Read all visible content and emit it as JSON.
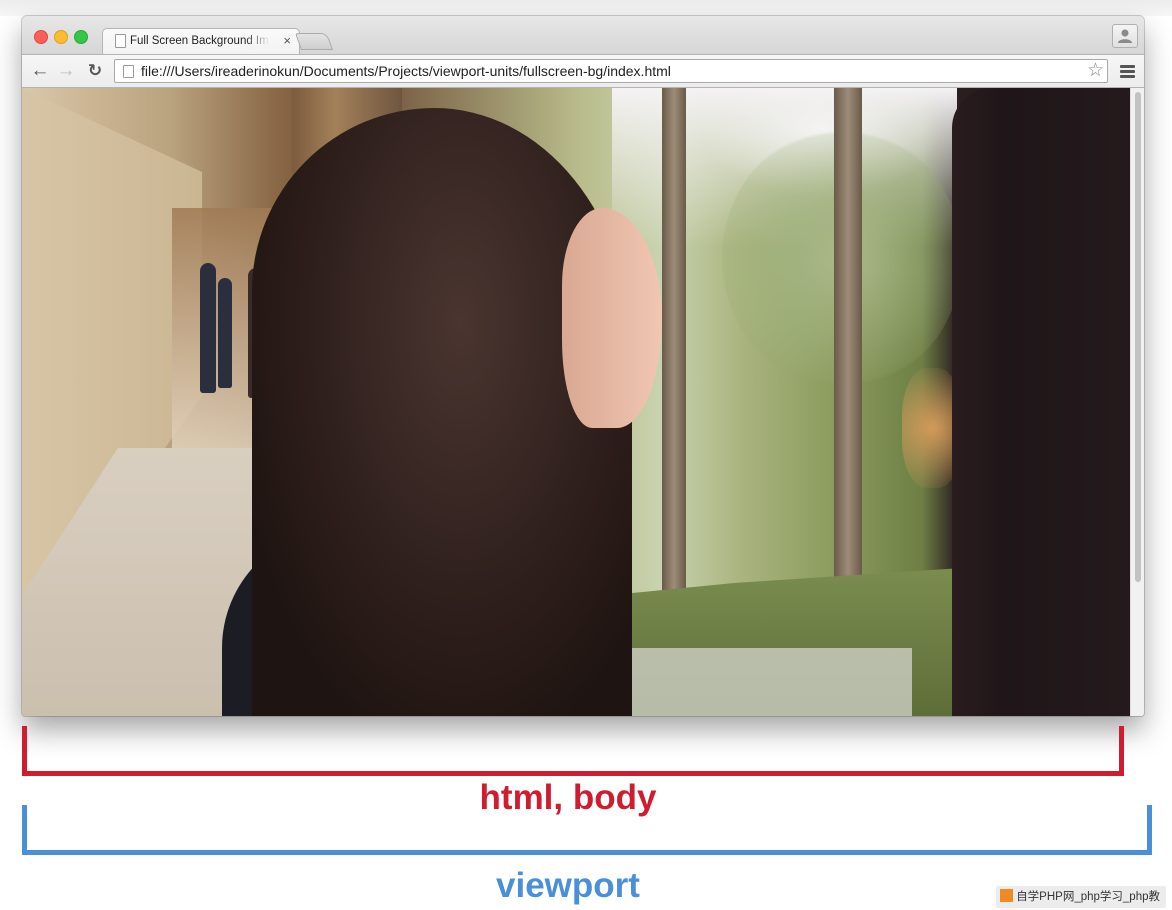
{
  "browser": {
    "tab_title": "Full Screen Background Im",
    "tab_close": "×",
    "url": "file:///Users/ireaderinokun/Documents/Projects/viewport-units/fullscreen-bg/index.html",
    "back_glyph": "←",
    "forward_glyph": "→",
    "reload_glyph": "↻",
    "star_glyph": "☆"
  },
  "page": {
    "image_description_icon": "photo-icon"
  },
  "annotations": {
    "html_body_label": "html, body",
    "html_body_color": "#cf1c2f",
    "viewport_label": "viewport",
    "viewport_color": "#4a8fd9"
  },
  "watermark": {
    "text": "自学PHP网_php学习_php教"
  }
}
